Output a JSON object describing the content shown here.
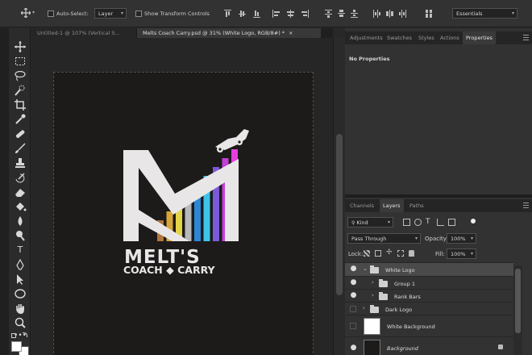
{
  "options_bar": {
    "auto_select_label": "Auto-Select:",
    "auto_select_value": "Layer",
    "show_transform_label": "Show Transform Controls",
    "workspace": "Essentials"
  },
  "tabs": [
    {
      "label": "Untitled-1 @ 107% (Vertical S...",
      "close": "×",
      "active": false
    },
    {
      "label": "Melts Coach Carry.psd @ 31% (White Logo, RGB/8#) *",
      "close": "×",
      "active": true
    }
  ],
  "canvas": {
    "logo_text_line1": "MELT'S",
    "logo_text_line2": "COACH ◆ CARRY",
    "bar_colors": [
      "#b2773a",
      "#d7a63a",
      "#e3d547",
      "#b9b9b9",
      "#2b86d6",
      "#3ec3e8",
      "#7b5ad8",
      "#c23fd8",
      "#e53ee1"
    ],
    "logo_fill": "#e8e6e6",
    "background": "#1d1a1a"
  },
  "top_panel": {
    "tabs": [
      "Adjustments",
      "Swatches",
      "Styles",
      "Actions",
      "Properties"
    ],
    "active_tab": "Properties",
    "message": "No Properties"
  },
  "layers_panel": {
    "tabs": [
      "Channels",
      "Layers",
      "Paths"
    ],
    "active_tab": "Layers",
    "filter_kind": "Kind",
    "blend_mode": "Pass Through",
    "opacity_label": "Opacity:",
    "opacity_value": "100%",
    "lock_label": "Lock:",
    "fill_label": "Fill:",
    "fill_value": "100%",
    "layers": [
      {
        "name": "White Logo",
        "type": "group",
        "visible": true,
        "selected": true,
        "indent": 0,
        "expanded": true
      },
      {
        "name": "Group 1",
        "type": "group",
        "visible": true,
        "selected": false,
        "indent": 1,
        "expanded": false
      },
      {
        "name": "Rank Bars",
        "type": "group",
        "visible": true,
        "selected": false,
        "indent": 1,
        "expanded": false
      },
      {
        "name": "Dark Logo",
        "type": "group",
        "visible": false,
        "selected": false,
        "indent": 0,
        "expanded": false
      },
      {
        "name": "White Background",
        "type": "pixel",
        "visible": false,
        "selected": false,
        "thumb_color": "#ffffff"
      },
      {
        "name": "Background",
        "type": "pixel",
        "visible": true,
        "selected": false,
        "thumb_color": "#1d1a1a",
        "locked": true
      }
    ]
  },
  "tools": [
    "move-icon",
    "marquee-icon",
    "lasso-icon",
    "quick-select-icon",
    "crop-icon",
    "eyedropper-icon",
    "healing-brush-icon",
    "brush-icon",
    "clone-stamp-icon",
    "history-brush-icon",
    "eraser-icon",
    "paint-bucket-icon",
    "blur-icon",
    "dodge-icon",
    "type-icon",
    "pen-icon",
    "path-select-icon",
    "ellipse-icon",
    "hand-icon",
    "zoom-icon",
    "more-icon"
  ],
  "tool_glyphs": {
    "type": "T",
    "more": "•••"
  }
}
